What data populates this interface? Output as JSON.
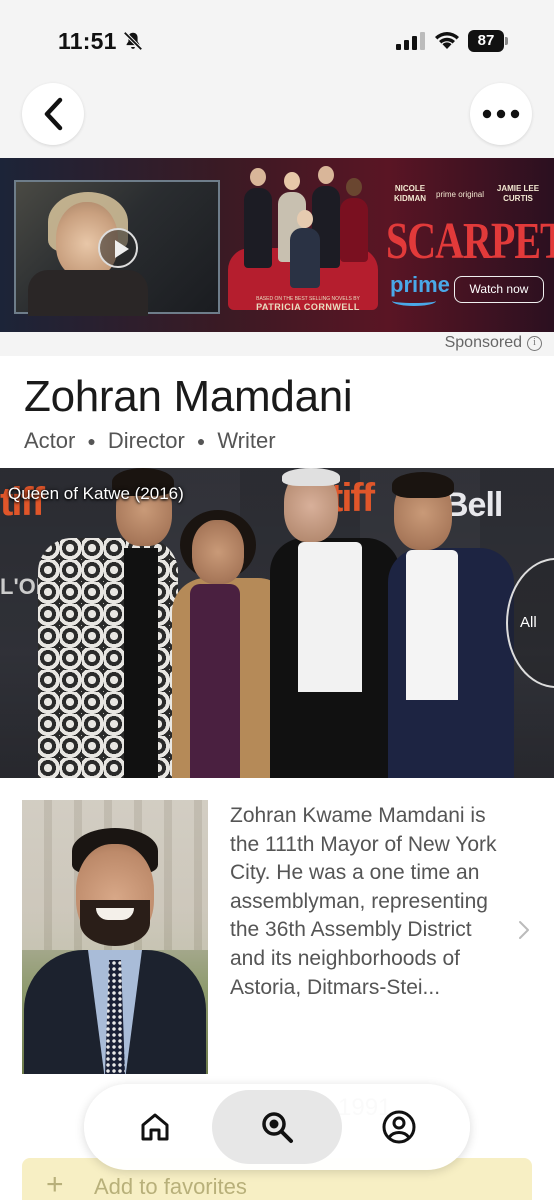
{
  "status_bar": {
    "time": "11:51",
    "battery": "87"
  },
  "nav": {
    "back_icon": "chevron-left-icon",
    "more_icon": "ellipsis-icon"
  },
  "ad": {
    "actor_left": "NICOLE KIDMAN",
    "network": "prime original",
    "actor_right": "JAMIE LEE CURTIS",
    "title": "SCARPETTA",
    "based_on": "BASED ON THE BEST SELLING NOVELS BY",
    "author": "PATRICIA CORNWELL",
    "brand": "prime",
    "cta": "Watch now",
    "sponsored": "Sponsored"
  },
  "profile": {
    "name": "Zohran Mamdani",
    "roles": [
      "Actor",
      "Director",
      "Writer"
    ]
  },
  "hero": {
    "caption": "Queen of Katwe (2016)",
    "all_label": "All",
    "logos": [
      "tiff",
      "tiff",
      "Bell",
      "L'ORÉAL"
    ]
  },
  "bio": {
    "text": "Zohran Kwame Mamdani is the 111th Mayor of New York City. He was a one time an assemblyman, representing the 36th Assembly District and its neighborhoods of Astoria, Ditmars-Stei...",
    "born_partial": "1991"
  },
  "favorites": {
    "label": "Add to favorites"
  },
  "tabbar": {
    "items": [
      {
        "name": "home",
        "icon": "home-icon",
        "active": false
      },
      {
        "name": "search",
        "icon": "search-icon",
        "active": true
      },
      {
        "name": "profile",
        "icon": "account-icon",
        "active": false
      }
    ]
  },
  "colors": {
    "ad_title": "#e23a3a",
    "prime_blue": "#4aa8e8",
    "favorites_bg": "#f7efc4",
    "tiff_orange": "#e0562a"
  }
}
